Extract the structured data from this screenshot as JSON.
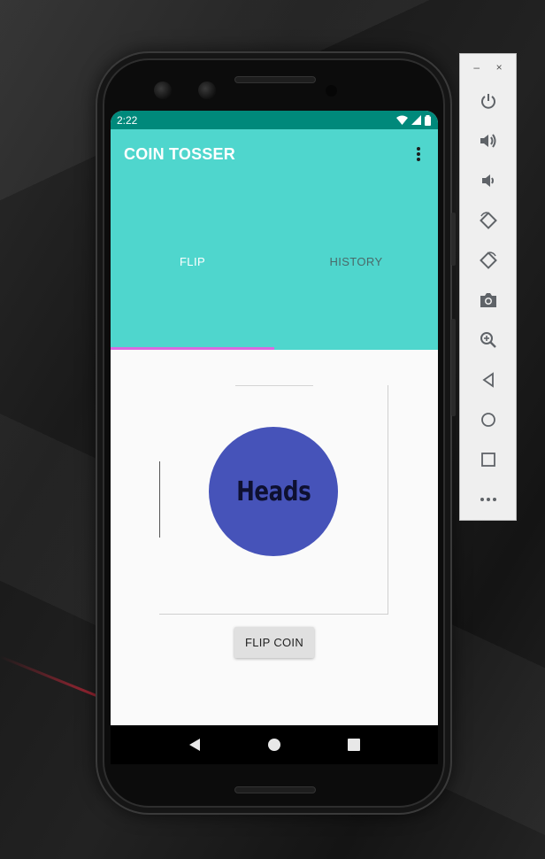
{
  "status_bar": {
    "time": "2:22"
  },
  "app": {
    "title": "COIN TOSSER"
  },
  "tabs": [
    {
      "label": "FLIP",
      "active": true
    },
    {
      "label": "HISTORY",
      "active": false
    }
  ],
  "coin": {
    "result": "Heads",
    "color": "#4653b9"
  },
  "flip_button": {
    "label": "FLIP COIN"
  },
  "colors": {
    "status_bar": "#00897b",
    "app_bar": "#4fd6cd",
    "tab_indicator": "#d96ae0"
  },
  "system_nav": {
    "buttons": [
      "back-icon",
      "home-icon",
      "overview-icon"
    ]
  },
  "emulator_toolbar": {
    "window_controls": {
      "minimize": "–",
      "close": "×"
    },
    "buttons": [
      "power-icon",
      "volume-up-icon",
      "volume-down-icon",
      "rotate-left-icon",
      "rotate-right-icon",
      "camera-icon",
      "zoom-icon",
      "back-icon",
      "home-icon",
      "overview-icon",
      "more-icon"
    ]
  }
}
